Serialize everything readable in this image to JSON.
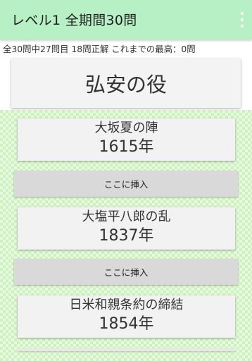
{
  "appbar": {
    "title": "レベル1 全期間30問",
    "menu_icon": "overflow-menu-icon"
  },
  "status": {
    "text": "全30問中27問目 18問正解 これまでの最高：0問"
  },
  "question": {
    "event": "弘安の役"
  },
  "timeline": [
    {
      "event": "大坂夏の陣",
      "year": "1615年"
    },
    {
      "event": "大塩平八郎の乱",
      "year": "1837年"
    },
    {
      "event": "日米和親条約の締結",
      "year": "1854年"
    }
  ],
  "insert_buttons": [
    {
      "label": "ここに挿入"
    },
    {
      "label": "ここに挿入"
    }
  ],
  "colors": {
    "appbar": "#b7f0c5",
    "field": "#cdf2bd",
    "card": "#f2f2f2",
    "button": "#d9d9d9"
  }
}
